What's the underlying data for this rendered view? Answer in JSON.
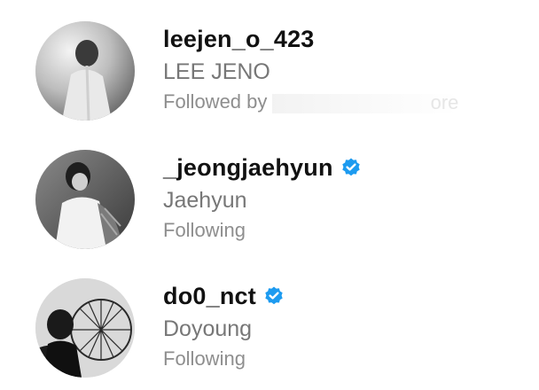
{
  "accounts": [
    {
      "username": "leejen_o_423",
      "full_name": "LEE JENO",
      "status": "Followed by",
      "status_tail": "ore",
      "verified": false,
      "avatar_icon": "profile-photo"
    },
    {
      "username": "_jeongjaehyun",
      "full_name": "Jaehyun",
      "status": "Following",
      "verified": true,
      "avatar_icon": "profile-photo"
    },
    {
      "username": "do0_nct",
      "full_name": "Doyoung",
      "status": "Following",
      "verified": true,
      "avatar_icon": "profile-photo"
    }
  ],
  "colors": {
    "verified_badge": "#1d9bf0",
    "username_text": "#111111",
    "secondary_text": "#8e8e8e"
  }
}
